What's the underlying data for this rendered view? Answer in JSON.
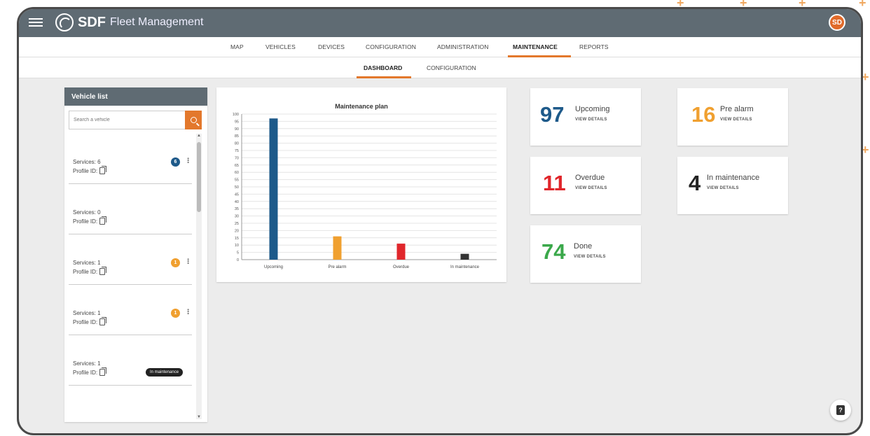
{
  "app": {
    "title_brand": "SDF",
    "title_rest": "Fleet Management",
    "avatar_initials": "SD"
  },
  "main_nav": {
    "tabs": [
      "MAP",
      "VEHICLES",
      "DEVICES",
      "CONFIGURATION",
      "ADMINISTRATION",
      "MAINTENANCE",
      "REPORTS"
    ],
    "active": "MAINTENANCE"
  },
  "sub_nav": {
    "tabs": [
      "DASHBOARD",
      "CONFIGURATION"
    ],
    "active": "DASHBOARD"
  },
  "vehicle_list": {
    "title": "Vehicle list",
    "search_placeholder": "Search a vehicle",
    "items": [
      {
        "services": "Services: 6",
        "profile": "Profile ID:",
        "badge": "6",
        "badge_color": "#1e5a8a"
      },
      {
        "services": "Services: 0",
        "profile": "Profile ID:",
        "badge": "",
        "badge_color": ""
      },
      {
        "services": "Services: 1",
        "profile": "Profile ID:",
        "badge": "1",
        "badge_color": "#f0a030"
      },
      {
        "services": "Services: 1",
        "profile": "Profile ID:",
        "badge": "1",
        "badge_color": "#f0a030"
      },
      {
        "services": "Services: 1",
        "profile": "Profile ID:",
        "badge": "",
        "badge_color": "",
        "pill": "In maintenance"
      }
    ]
  },
  "chart_data": {
    "type": "bar",
    "title": "Maintenance plan",
    "categories": [
      "Upcoming",
      "Pre alarm",
      "Overdue",
      "In maintenance"
    ],
    "values": [
      97,
      16,
      11,
      4
    ],
    "colors": [
      "#1e5a8a",
      "#f0a030",
      "#e0262b",
      "#333333"
    ],
    "ylim": [
      0,
      100
    ],
    "yticks": [
      0,
      5,
      10,
      15,
      20,
      25,
      30,
      35,
      40,
      45,
      50,
      55,
      60,
      65,
      70,
      75,
      80,
      85,
      90,
      95,
      100
    ],
    "grid": true
  },
  "stats": [
    {
      "key": "upcoming",
      "number": "97",
      "label": "Upcoming",
      "link": "VIEW DETAILS",
      "color": "#1e5a8a"
    },
    {
      "key": "pre_alarm",
      "number": "16",
      "label": "Pre alarm",
      "link": "VIEW DETAILS",
      "color": "#f0a030"
    },
    {
      "key": "overdue",
      "number": "11",
      "label": "Overdue",
      "link": "VIEW DETAILS",
      "color": "#e0262b"
    },
    {
      "key": "in_maintenance",
      "number": "4",
      "label": "In maintenance",
      "link": "VIEW DETAILS",
      "color": "#222222"
    },
    {
      "key": "done",
      "number": "74",
      "label": "Done",
      "link": "VIEW DETAILS",
      "color": "#3aa84a"
    }
  ],
  "accent_color": "#e3782c"
}
